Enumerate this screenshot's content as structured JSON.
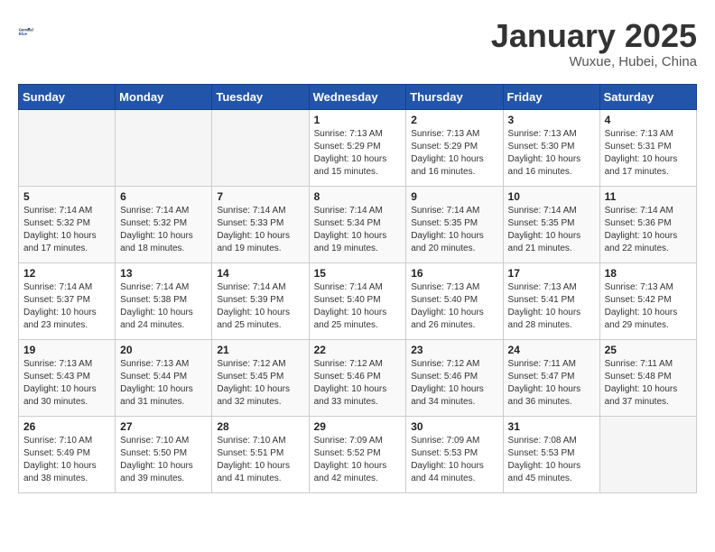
{
  "header": {
    "logo_general": "General",
    "logo_blue": "Blue",
    "month_title": "January 2025",
    "location": "Wuxue, Hubei, China"
  },
  "days_of_week": [
    "Sunday",
    "Monday",
    "Tuesday",
    "Wednesday",
    "Thursday",
    "Friday",
    "Saturday"
  ],
  "weeks": [
    [
      {
        "day": "",
        "info": ""
      },
      {
        "day": "",
        "info": ""
      },
      {
        "day": "",
        "info": ""
      },
      {
        "day": "1",
        "info": "Sunrise: 7:13 AM\nSunset: 5:29 PM\nDaylight: 10 hours\nand 15 minutes."
      },
      {
        "day": "2",
        "info": "Sunrise: 7:13 AM\nSunset: 5:29 PM\nDaylight: 10 hours\nand 16 minutes."
      },
      {
        "day": "3",
        "info": "Sunrise: 7:13 AM\nSunset: 5:30 PM\nDaylight: 10 hours\nand 16 minutes."
      },
      {
        "day": "4",
        "info": "Sunrise: 7:13 AM\nSunset: 5:31 PM\nDaylight: 10 hours\nand 17 minutes."
      }
    ],
    [
      {
        "day": "5",
        "info": "Sunrise: 7:14 AM\nSunset: 5:32 PM\nDaylight: 10 hours\nand 17 minutes."
      },
      {
        "day": "6",
        "info": "Sunrise: 7:14 AM\nSunset: 5:32 PM\nDaylight: 10 hours\nand 18 minutes."
      },
      {
        "day": "7",
        "info": "Sunrise: 7:14 AM\nSunset: 5:33 PM\nDaylight: 10 hours\nand 19 minutes."
      },
      {
        "day": "8",
        "info": "Sunrise: 7:14 AM\nSunset: 5:34 PM\nDaylight: 10 hours\nand 19 minutes."
      },
      {
        "day": "9",
        "info": "Sunrise: 7:14 AM\nSunset: 5:35 PM\nDaylight: 10 hours\nand 20 minutes."
      },
      {
        "day": "10",
        "info": "Sunrise: 7:14 AM\nSunset: 5:35 PM\nDaylight: 10 hours\nand 21 minutes."
      },
      {
        "day": "11",
        "info": "Sunrise: 7:14 AM\nSunset: 5:36 PM\nDaylight: 10 hours\nand 22 minutes."
      }
    ],
    [
      {
        "day": "12",
        "info": "Sunrise: 7:14 AM\nSunset: 5:37 PM\nDaylight: 10 hours\nand 23 minutes."
      },
      {
        "day": "13",
        "info": "Sunrise: 7:14 AM\nSunset: 5:38 PM\nDaylight: 10 hours\nand 24 minutes."
      },
      {
        "day": "14",
        "info": "Sunrise: 7:14 AM\nSunset: 5:39 PM\nDaylight: 10 hours\nand 25 minutes."
      },
      {
        "day": "15",
        "info": "Sunrise: 7:14 AM\nSunset: 5:40 PM\nDaylight: 10 hours\nand 25 minutes."
      },
      {
        "day": "16",
        "info": "Sunrise: 7:13 AM\nSunset: 5:40 PM\nDaylight: 10 hours\nand 26 minutes."
      },
      {
        "day": "17",
        "info": "Sunrise: 7:13 AM\nSunset: 5:41 PM\nDaylight: 10 hours\nand 28 minutes."
      },
      {
        "day": "18",
        "info": "Sunrise: 7:13 AM\nSunset: 5:42 PM\nDaylight: 10 hours\nand 29 minutes."
      }
    ],
    [
      {
        "day": "19",
        "info": "Sunrise: 7:13 AM\nSunset: 5:43 PM\nDaylight: 10 hours\nand 30 minutes."
      },
      {
        "day": "20",
        "info": "Sunrise: 7:13 AM\nSunset: 5:44 PM\nDaylight: 10 hours\nand 31 minutes."
      },
      {
        "day": "21",
        "info": "Sunrise: 7:12 AM\nSunset: 5:45 PM\nDaylight: 10 hours\nand 32 minutes."
      },
      {
        "day": "22",
        "info": "Sunrise: 7:12 AM\nSunset: 5:46 PM\nDaylight: 10 hours\nand 33 minutes."
      },
      {
        "day": "23",
        "info": "Sunrise: 7:12 AM\nSunset: 5:46 PM\nDaylight: 10 hours\nand 34 minutes."
      },
      {
        "day": "24",
        "info": "Sunrise: 7:11 AM\nSunset: 5:47 PM\nDaylight: 10 hours\nand 36 minutes."
      },
      {
        "day": "25",
        "info": "Sunrise: 7:11 AM\nSunset: 5:48 PM\nDaylight: 10 hours\nand 37 minutes."
      }
    ],
    [
      {
        "day": "26",
        "info": "Sunrise: 7:10 AM\nSunset: 5:49 PM\nDaylight: 10 hours\nand 38 minutes."
      },
      {
        "day": "27",
        "info": "Sunrise: 7:10 AM\nSunset: 5:50 PM\nDaylight: 10 hours\nand 39 minutes."
      },
      {
        "day": "28",
        "info": "Sunrise: 7:10 AM\nSunset: 5:51 PM\nDaylight: 10 hours\nand 41 minutes."
      },
      {
        "day": "29",
        "info": "Sunrise: 7:09 AM\nSunset: 5:52 PM\nDaylight: 10 hours\nand 42 minutes."
      },
      {
        "day": "30",
        "info": "Sunrise: 7:09 AM\nSunset: 5:53 PM\nDaylight: 10 hours\nand 44 minutes."
      },
      {
        "day": "31",
        "info": "Sunrise: 7:08 AM\nSunset: 5:53 PM\nDaylight: 10 hours\nand 45 minutes."
      },
      {
        "day": "",
        "info": ""
      }
    ]
  ]
}
